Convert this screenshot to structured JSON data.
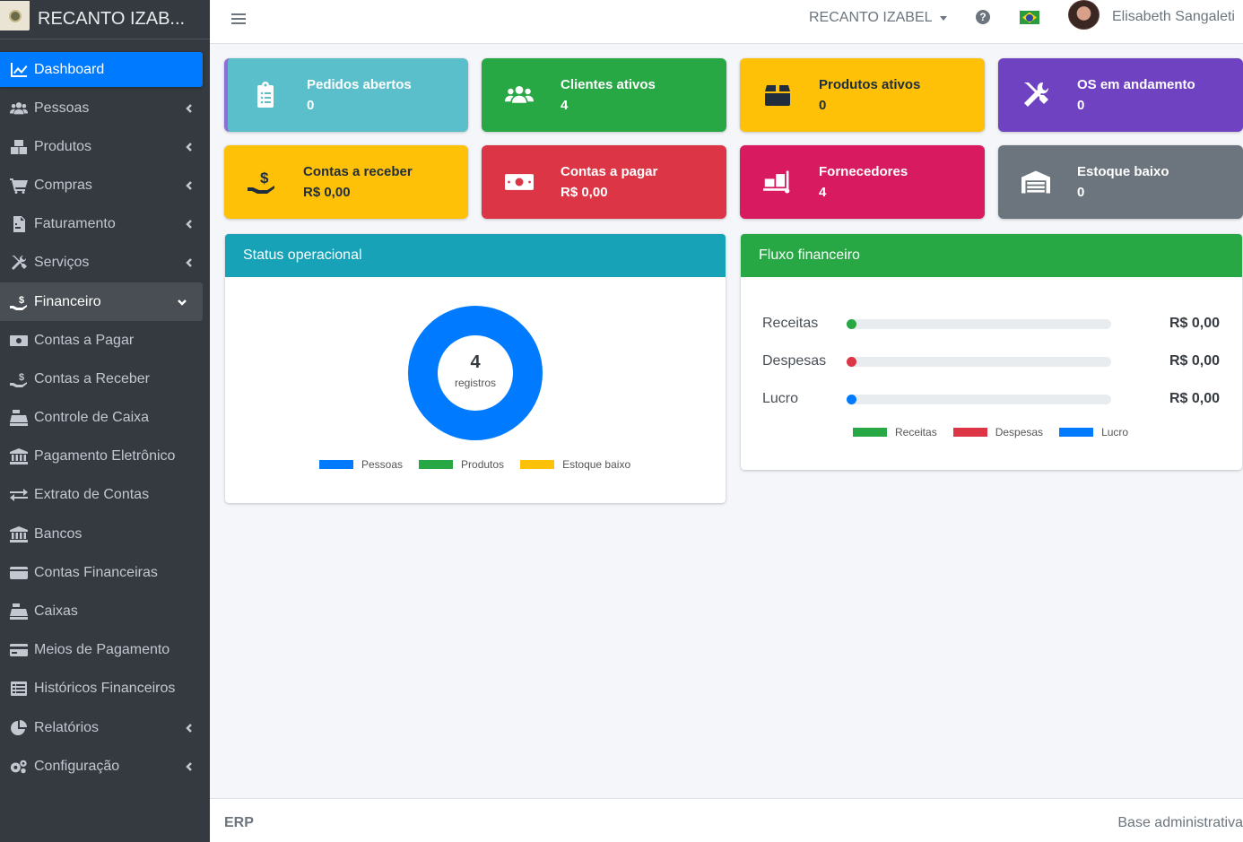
{
  "brand": {
    "name": "RECANTO IZAB..."
  },
  "sidebar": {
    "items": [
      {
        "label": "Dashboard",
        "icon": "chart-line-icon"
      },
      {
        "label": "Pessoas",
        "icon": "users-icon"
      },
      {
        "label": "Produtos",
        "icon": "boxes-icon"
      },
      {
        "label": "Compras",
        "icon": "cart-icon"
      },
      {
        "label": "Faturamento",
        "icon": "invoice-icon"
      },
      {
        "label": "Serviços",
        "icon": "tools-icon"
      },
      {
        "label": "Financeiro",
        "icon": "hand-dollar-icon"
      },
      {
        "label": "Contas a Pagar",
        "icon": "money-bill-icon"
      },
      {
        "label": "Contas a Receber",
        "icon": "hand-dollar-icon"
      },
      {
        "label": "Controle de Caixa",
        "icon": "cash-register-icon"
      },
      {
        "label": "Pagamento Eletrônico",
        "icon": "bank-icon"
      },
      {
        "label": "Extrato de Contas",
        "icon": "exchange-icon"
      },
      {
        "label": "Bancos",
        "icon": "bank-icon"
      },
      {
        "label": "Contas Financeiras",
        "icon": "wallet-icon"
      },
      {
        "label": "Caixas",
        "icon": "cash-register-icon"
      },
      {
        "label": "Meios de Pagamento",
        "icon": "credit-card-icon"
      },
      {
        "label": "Históricos Financeiros",
        "icon": "list-icon"
      },
      {
        "label": "Relatórios",
        "icon": "pie-chart-icon"
      },
      {
        "label": "Configuração",
        "icon": "cogs-icon"
      }
    ]
  },
  "topbar": {
    "company": "RECANTO IZABEL",
    "help": "?",
    "user": "Elisabeth Sangaleti"
  },
  "info_boxes": [
    {
      "title": "Pedidos abertos",
      "value": "0",
      "icon": "clipboard-list-icon",
      "color": "#5bbfcb"
    },
    {
      "title": "Clientes ativos",
      "value": "4",
      "icon": "users-icon",
      "color": "#28a745"
    },
    {
      "title": "Produtos ativos",
      "value": "0",
      "icon": "box-icon",
      "color": "#ffc107"
    },
    {
      "title": "OS em andamento",
      "value": "0",
      "icon": "tools-icon",
      "color": "#6f42c1"
    },
    {
      "title": "Contas a receber",
      "value": "R$ 0,00",
      "icon": "hand-dollar-icon",
      "color": "#ffc107"
    },
    {
      "title": "Contas a pagar",
      "value": "R$ 0,00",
      "icon": "money-bill-icon",
      "color": "#dc3545"
    },
    {
      "title": "Fornecedores",
      "value": "4",
      "icon": "dolly-icon",
      "color": "#d81b60"
    },
    {
      "title": "Estoque baixo",
      "value": "0",
      "icon": "warehouse-icon",
      "color": "#6c757d"
    }
  ],
  "status_card": {
    "title": "Status operacional",
    "header_color": "#17a2b8",
    "center_value": "4",
    "center_label": "registros",
    "legend": [
      {
        "label": "Pessoas",
        "color": "#007bff"
      },
      {
        "label": "Produtos",
        "color": "#28a745"
      },
      {
        "label": "Estoque baixo",
        "color": "#ffc107"
      }
    ]
  },
  "chart_data": {
    "type": "pie",
    "categories": [
      "Pessoas",
      "Produtos",
      "Estoque baixo"
    ],
    "values": [
      4,
      0,
      0
    ],
    "colors": [
      "#007bff",
      "#28a745",
      "#ffc107"
    ],
    "legend_position": "bottom"
  },
  "flow_card": {
    "title": "Fluxo financeiro",
    "header_color": "#28a745",
    "rows": [
      {
        "label": "Receitas",
        "value": "R$ 0,00",
        "fraction": 0,
        "color": "#28a745"
      },
      {
        "label": "Despesas",
        "value": "R$ 0,00",
        "fraction": 0,
        "color": "#dc3545"
      },
      {
        "label": "Lucro",
        "value": "R$ 0,00",
        "fraction": 0,
        "color": "#007bff"
      }
    ],
    "legend": [
      {
        "label": "Receitas",
        "color": "#28a745"
      },
      {
        "label": "Despesas",
        "color": "#dc3545"
      },
      {
        "label": "Lucro",
        "color": "#007bff"
      }
    ]
  },
  "footer": {
    "left": "ERP",
    "right": "Base administrativa"
  }
}
